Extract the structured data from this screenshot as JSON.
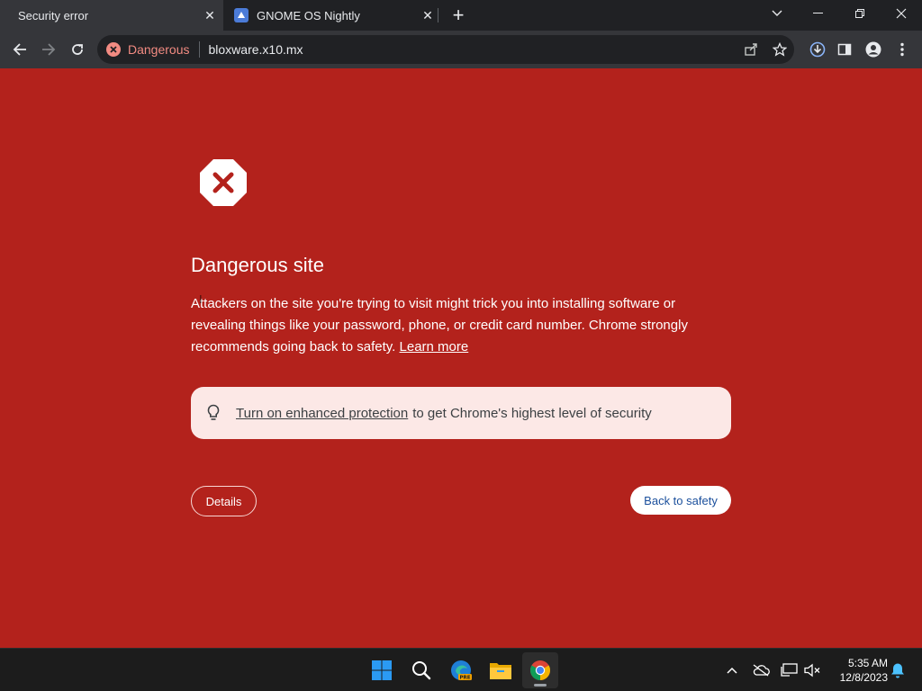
{
  "tabs": [
    {
      "title": "Security error",
      "active": true
    },
    {
      "title": "GNOME OS Nightly",
      "active": false
    }
  ],
  "toolbar": {
    "security_chip": "Dangerous",
    "url": "bloxware.x10.mx"
  },
  "page": {
    "heading": "Dangerous site",
    "body": "Attackers on the site you're trying to visit might trick you into installing software or revealing things like your password, phone, or credit card number. Chrome strongly recommends going back to safety. ",
    "learn_more": "Learn more",
    "protection_link": "Turn on enhanced protection",
    "protection_rest": "to get Chrome's highest level of security",
    "details_button": "Details",
    "back_button": "Back to safety"
  },
  "taskbar": {
    "apps": [
      "start",
      "search",
      "edge-preview",
      "file-explorer",
      "chrome"
    ],
    "time": "5:35 AM",
    "date": "12/8/2023"
  },
  "colors": {
    "danger_red": "#b3221c",
    "chip_red": "#f28b82",
    "info_box": "#fce8e6",
    "link_blue": "#1a4f9c"
  },
  "icons": [
    "close-icon",
    "new-tab-icon",
    "back-icon",
    "forward-icon",
    "reload-icon",
    "share-icon",
    "bookmark-star-icon",
    "download-icon",
    "side-panel-icon",
    "profile-icon",
    "menu-icon",
    "stop-icon",
    "lightbulb-icon"
  ]
}
